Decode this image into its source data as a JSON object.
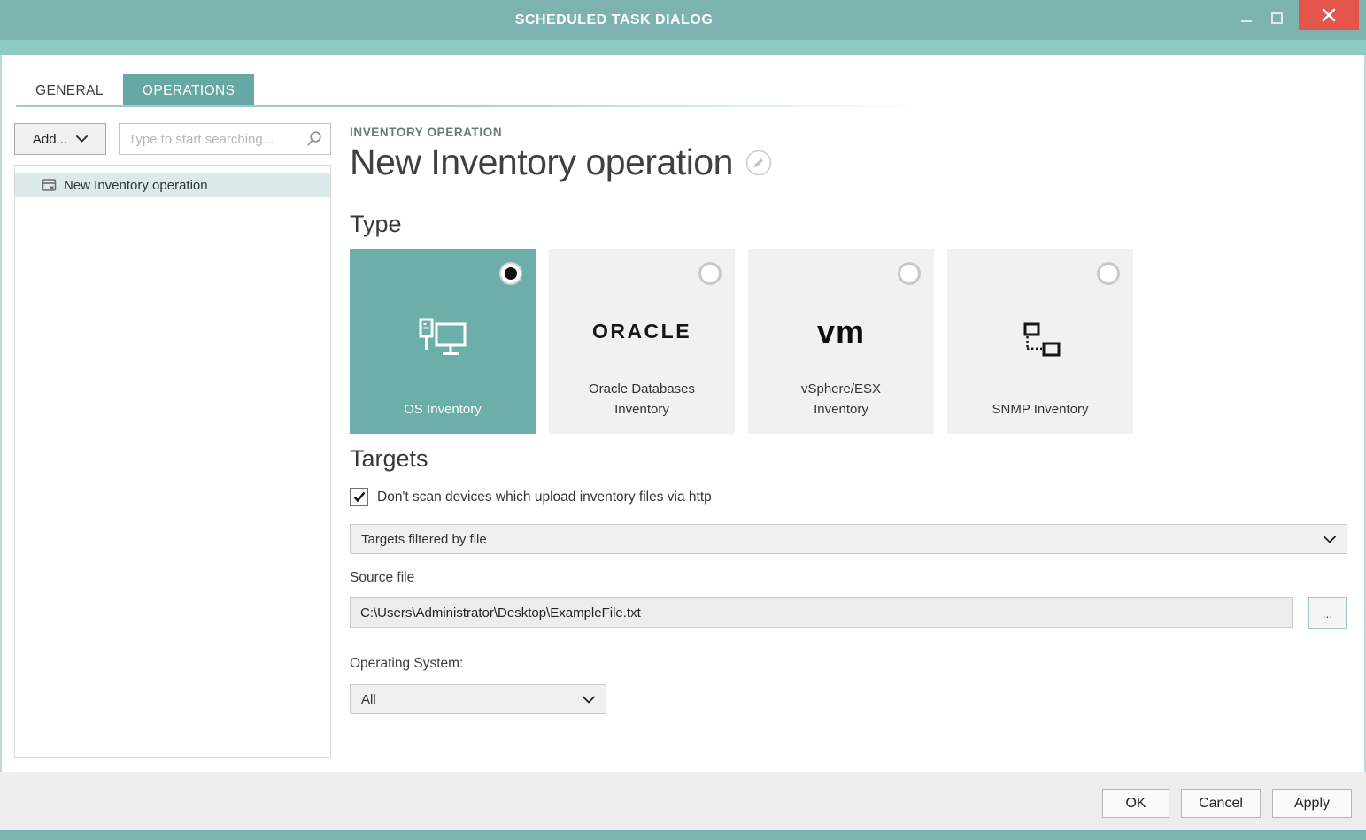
{
  "window": {
    "title": "SCHEDULED TASK DIALOG"
  },
  "tabs": [
    {
      "label": "GENERAL",
      "active": false
    },
    {
      "label": "OPERATIONS",
      "active": true
    }
  ],
  "sidebar": {
    "add_button_label": "Add...",
    "search_placeholder": "Type to start searching...",
    "items": [
      {
        "label": "New Inventory operation",
        "selected": true
      }
    ]
  },
  "main": {
    "eyebrow": "INVENTORY OPERATION",
    "title": "New Inventory operation",
    "type_section": {
      "heading": "Type",
      "options": [
        {
          "label": "OS Inventory",
          "icon": "os-inventory-icon",
          "selected": true
        },
        {
          "label": "Oracle Databases Inventory",
          "icon": "oracle-logo",
          "logo_text": "ORACLE",
          "selected": false
        },
        {
          "label": "vSphere/ESX Inventory",
          "icon": "vmware-logo",
          "logo_text": "vm",
          "selected": false
        },
        {
          "label": "SNMP Inventory",
          "icon": "snmp-icon",
          "selected": false
        }
      ]
    },
    "targets_section": {
      "heading": "Targets",
      "checkbox": {
        "label": "Don't scan devices which upload inventory files via http",
        "checked": true
      },
      "filter_dropdown": {
        "value": "Targets filtered by file"
      },
      "source_file": {
        "label": "Source file",
        "value": "C:\\Users\\Administrator\\Desktop\\ExampleFile.txt",
        "browse_label": "..."
      },
      "operating_system": {
        "label": "Operating System:",
        "value": "All"
      }
    }
  },
  "footer": {
    "ok_label": "OK",
    "cancel_label": "Cancel",
    "apply_label": "Apply"
  },
  "colors": {
    "titlebar": "#7cb3b0",
    "accent": "#65a8a4",
    "tile_selected": "#6cafaa",
    "close_button": "#e4564c",
    "subbar": "#8ecac6"
  }
}
